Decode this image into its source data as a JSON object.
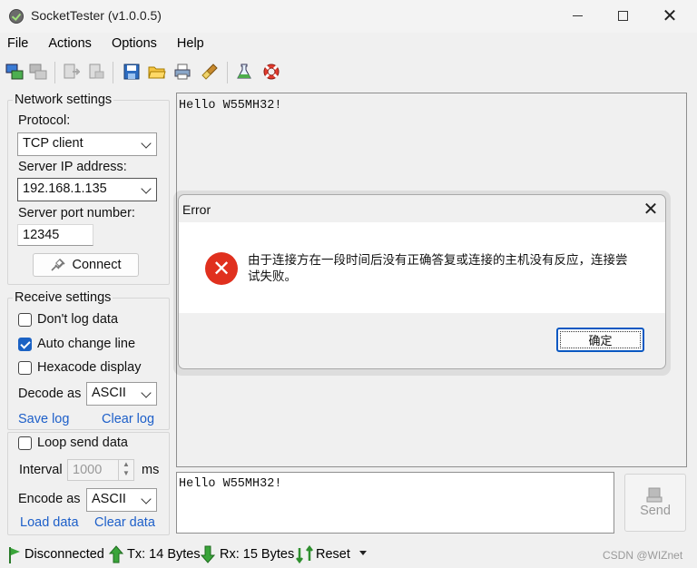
{
  "window": {
    "title": "SocketTester (v1.0.0.5)"
  },
  "menu": [
    "File",
    "Actions",
    "Options",
    "Help"
  ],
  "toolbar": {
    "icons": [
      "connect-icon",
      "disconnect-icon",
      "send-file-icon",
      "receive-file-icon",
      "save-icon",
      "open-folder-icon",
      "print-icon",
      "clear-brush-icon",
      "flask-icon",
      "lifebuoy-icon"
    ]
  },
  "network": {
    "group_title": "Network settings",
    "protocol_label": "Protocol:",
    "protocol_value": "TCP client",
    "server_ip_label": "Server IP address:",
    "server_ip_value": "192.168.1.135",
    "server_port_label": "Server port number:",
    "server_port_value": "12345",
    "connect_label": "Connect"
  },
  "receive": {
    "group_title": "Receive settings",
    "dont_log_label": "Don't log data",
    "dont_log_checked": false,
    "auto_change_line_label": "Auto change line",
    "auto_change_line_checked": true,
    "hexcode_label": "Hexacode display",
    "hexcode_checked": false,
    "decode_label": "Decode as",
    "decode_value": "ASCII",
    "save_log_label": "Save log",
    "clear_log_label": "Clear log"
  },
  "send_settings": {
    "loop_label": "Loop send data",
    "loop_checked": false,
    "interval_label": "Interval",
    "interval_value": "1000",
    "interval_unit": "ms",
    "encode_label": "Encode as",
    "encode_value": "ASCII",
    "load_data_label": "Load data",
    "clear_data_label": "Clear data"
  },
  "received_text": "Hello W55MH32!",
  "send_text": "Hello W55MH32!",
  "send_button_label": "Send",
  "status": {
    "connection": "Disconnected",
    "tx": "Tx: 14 Bytes",
    "rx": "Rx: 15 Bytes",
    "reset": "Reset"
  },
  "watermark": "CSDN @WIZnet",
  "dialog": {
    "title": "Error",
    "message": "由于连接方在一段时间后没有正确答复或连接的主机没有反应，连接尝试失败。",
    "ok_label": "确定"
  }
}
